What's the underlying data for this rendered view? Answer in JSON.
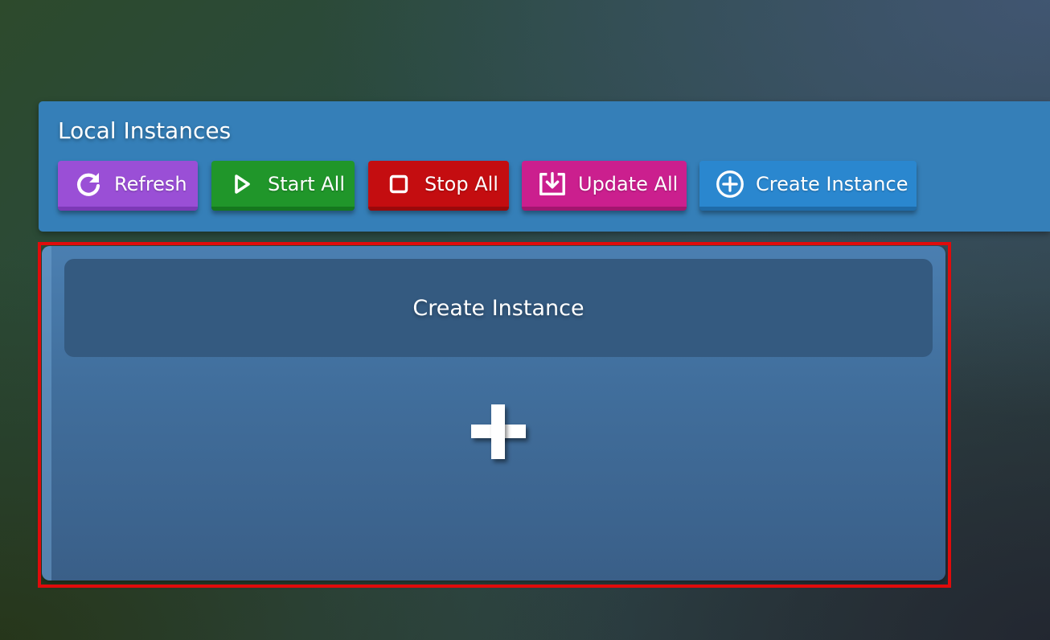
{
  "header": {
    "title": "Local Instances"
  },
  "toolbar": {
    "buttons": [
      {
        "label": "Refresh",
        "icon": "refresh-icon",
        "color": "#9a4fd6"
      },
      {
        "label": "Start All",
        "icon": "play-icon",
        "color": "#20962a"
      },
      {
        "label": "Stop All",
        "icon": "stop-icon",
        "color": "#c40d10"
      },
      {
        "label": "Update All",
        "icon": "download-icon",
        "color": "#cb1f8e"
      },
      {
        "label": "Create Instance",
        "icon": "plus-circle-icon",
        "color": "#2a87cf"
      }
    ]
  },
  "create_card": {
    "title": "Create Instance",
    "icon": "plus-icon"
  },
  "highlight": {
    "color": "#e00b0b"
  }
}
